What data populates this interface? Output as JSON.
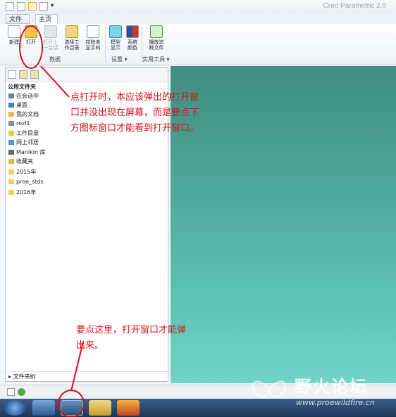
{
  "app_title": "Creo Parametric 2.0",
  "tabs": [
    {
      "label": "文件 ▾"
    },
    {
      "label": "主页"
    }
  ],
  "ribbon": {
    "buttons": [
      {
        "label": "新建"
      },
      {
        "label": "打开"
      },
      {
        "label": "打开上\n一会话"
      },
      {
        "label": "选择工\n作目录"
      },
      {
        "label": "拭除未\n显示的"
      },
      {
        "label": "模型\n显示"
      },
      {
        "label": "系统\n颜色"
      },
      {
        "label": "播放追\n踪文件"
      }
    ],
    "groups": [
      {
        "label": "数据"
      },
      {
        "label": "设置 ▾"
      },
      {
        "label": "实用工具 ▾"
      }
    ]
  },
  "navigator": {
    "header": "公用文件夹",
    "items": [
      {
        "label": "在会话中"
      },
      {
        "label": "桌面"
      },
      {
        "label": "我的文档"
      },
      {
        "label": "rezl1"
      },
      {
        "label": "工作目录"
      },
      {
        "label": "网上邻居"
      },
      {
        "label": "Manikin 库"
      },
      {
        "label": "收藏夹"
      },
      {
        "label": "2015年"
      },
      {
        "label": "proe_stds"
      },
      {
        "label": "2016年"
      }
    ],
    "footer": "文件夹树"
  },
  "annotations": {
    "note1": "点打开时，本应该弹出的打开窗口并没出现在屏幕，而是要点下方图标窗口才能看到打开窗口。",
    "note2": "要点这里，打开窗口才能弹出来。"
  },
  "watermark": {
    "text": "野火论坛",
    "url": "www.proewildfire.cn"
  },
  "colors": {
    "annotation": "#d4121a",
    "graphics_top": "#3f8e7f",
    "graphics_bottom": "#70d5c8",
    "taskbar": "#2a4a72"
  }
}
